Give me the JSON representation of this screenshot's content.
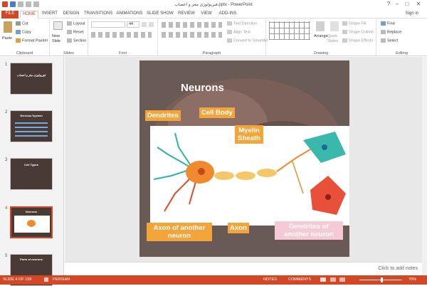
{
  "window": {
    "title": "فيزيولوژی مغز و اعصاب.pptx - PowerPoint",
    "sign_in": "Sign in"
  },
  "menu": {
    "tabs": [
      "FILE",
      "HOME",
      "INSERT",
      "DESIGN",
      "TRANSITIONS",
      "ANIMATIONS",
      "SLIDE SHOW",
      "REVIEW",
      "VIEW",
      "ADD-INS"
    ]
  },
  "ribbon": {
    "clipboard": {
      "label": "Clipboard",
      "paste": "Paste",
      "cut": "Cut",
      "copy": "Copy",
      "format_painter": "Format Painter"
    },
    "slides": {
      "label": "Slides",
      "new_slide": "New Slide",
      "layout": "Layout",
      "reset": "Reset",
      "section": "Section"
    },
    "font": {
      "label": "Font",
      "size": "44"
    },
    "paragraph": {
      "label": "Paragraph",
      "text_direction": "Text Direction",
      "align_text": "Align Text",
      "convert": "Convert to SmartArt"
    },
    "drawing": {
      "label": "Drawing",
      "arrange": "Arrange",
      "quick_styles": "Quick Styles",
      "shape_fill": "Shape Fill",
      "shape_outline": "Shape Outline",
      "shape_effects": "Shape Effects"
    },
    "editing": {
      "label": "Editing",
      "find": "Find",
      "replace": "Replace",
      "select": "Select"
    }
  },
  "thumbnails": [
    {
      "num": "1",
      "title": "فيزيولوژی مغز و اعصاب"
    },
    {
      "num": "2",
      "title": "Nervous System"
    },
    {
      "num": "3",
      "title": "Cell Types"
    },
    {
      "num": "4",
      "title": "Neurons"
    },
    {
      "num": "5",
      "title": "Parts of neurons"
    }
  ],
  "slide": {
    "title": "Neurons",
    "labels": {
      "dendrites": "Dendrites",
      "cell_body": "Cell Body",
      "myelin": "Myelin Sheath",
      "axon_another": "Axon of another neuron",
      "axon": "Axon",
      "dendrites_another": "Dendrites of another neuron"
    }
  },
  "notes": {
    "placeholder": "Click to add notes"
  },
  "status": {
    "slide_info": "SLIDE 4 OF 159",
    "language": "PERSIAN",
    "notes": "NOTES",
    "comments": "COMMENTS",
    "zoom": "70%"
  },
  "colors": {
    "accent": "#d24726",
    "label_orange": "#f3a53a",
    "label_pink": "#f6c9d6"
  }
}
